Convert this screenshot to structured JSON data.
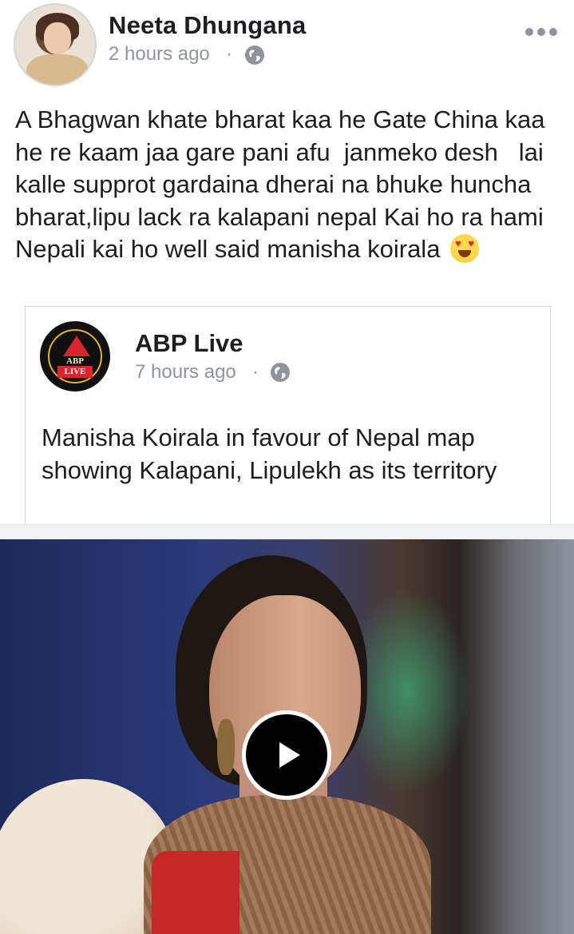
{
  "post": {
    "author": "Neeta Dhungana",
    "time": "2 hours ago",
    "separator": "·",
    "privacy_icon": "globe-icon",
    "menu_icon": "more-options-icon",
    "text": "A Bhagwan khate bharat kaa he Gate China kaa he re kaam jaa gare pani afu  janmeko desh   lai  kalle supprot gardaina dherai na bhuke huncha bharat,lipu lack ra kalapani nepal Kai ho ra hami Nepali kai ho well said manisha koirala",
    "emoji": "heart-eyes-emoji"
  },
  "shared": {
    "page_name": "ABP Live",
    "time": "7 hours ago",
    "separator": "·",
    "logo": {
      "top": "ABP",
      "bottom": "LIVE"
    },
    "text": "Manisha Koirala in favour of Nepal map showing Kalapani, Lipulekh as its territory",
    "video": {
      "play_icon": "play-icon"
    }
  },
  "colors": {
    "text": "#1c1e21",
    "meta": "#8d949e",
    "border": "#d0d3d8",
    "logo_red": "#d9262c"
  }
}
